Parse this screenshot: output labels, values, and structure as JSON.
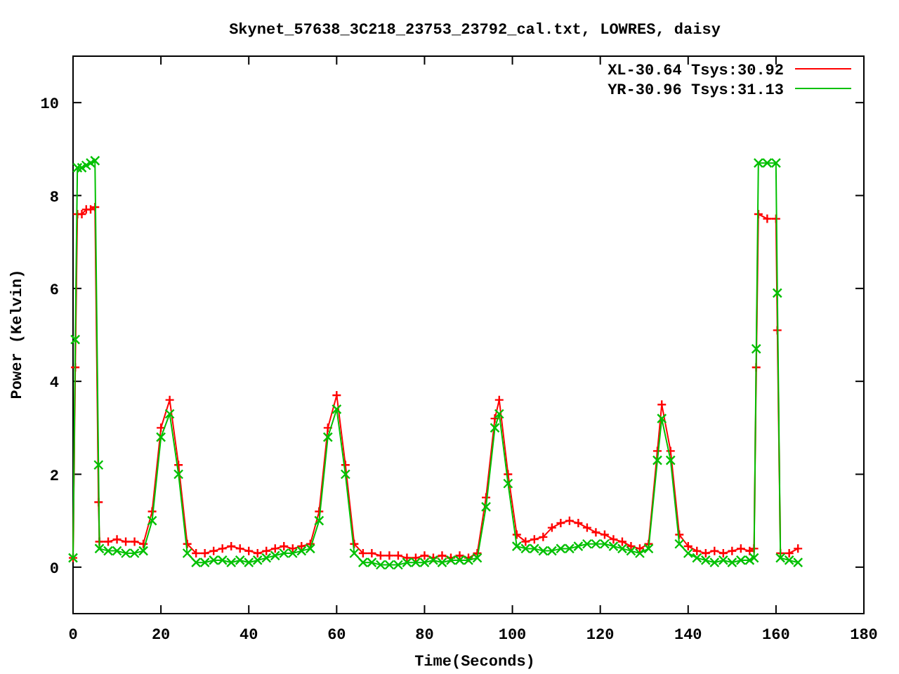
{
  "chart_data": {
    "type": "line",
    "title": "Skynet_57638_3C218_23753_23792_cal.txt, LOWRES, daisy",
    "xlabel": "Time(Seconds)",
    "ylabel": "Power (Kelvin)",
    "x": [
      0,
      0.5,
      1,
      2,
      3,
      4,
      5,
      5.8,
      6,
      8,
      10,
      12,
      14,
      16,
      18,
      20,
      22,
      24,
      26,
      28,
      30,
      32,
      34,
      36,
      38,
      40,
      42,
      44,
      46,
      48,
      50,
      52,
      54,
      56,
      58,
      60,
      62,
      64,
      66,
      68,
      70,
      72,
      74,
      76,
      78,
      80,
      82,
      84,
      86,
      88,
      90,
      92,
      94,
      96,
      97,
      99,
      101,
      103,
      105,
      107,
      109,
      111,
      113,
      115,
      117,
      119,
      121,
      123,
      125,
      127,
      129,
      131,
      133,
      134,
      136,
      138,
      140,
      142,
      144,
      146,
      148,
      150,
      152,
      154,
      155,
      155.5,
      156,
      158,
      160,
      160.3,
      161,
      163,
      165
    ],
    "series": [
      {
        "name": "XL-30.64 Tsys:30.92",
        "color": "#ff0000",
        "marker": "plus",
        "values": [
          0.2,
          4.3,
          7.6,
          7.6,
          7.7,
          7.7,
          7.75,
          1.4,
          0.55,
          0.55,
          0.6,
          0.55,
          0.55,
          0.5,
          1.2,
          3.0,
          3.6,
          2.2,
          0.5,
          0.3,
          0.3,
          0.35,
          0.4,
          0.45,
          0.4,
          0.35,
          0.3,
          0.35,
          0.4,
          0.45,
          0.4,
          0.45,
          0.5,
          1.2,
          3.0,
          3.7,
          2.2,
          0.5,
          0.3,
          0.3,
          0.25,
          0.25,
          0.25,
          0.2,
          0.2,
          0.25,
          0.2,
          0.25,
          0.2,
          0.25,
          0.2,
          0.3,
          1.5,
          3.2,
          3.6,
          2.0,
          0.7,
          0.55,
          0.6,
          0.65,
          0.85,
          0.95,
          1.0,
          0.95,
          0.85,
          0.75,
          0.7,
          0.6,
          0.55,
          0.45,
          0.4,
          0.5,
          2.5,
          3.5,
          2.5,
          0.7,
          0.45,
          0.35,
          0.3,
          0.35,
          0.3,
          0.35,
          0.4,
          0.35,
          0.4,
          4.3,
          7.6,
          7.5,
          7.5,
          5.1,
          0.3,
          0.3,
          0.4
        ]
      },
      {
        "name": "YR-30.96 Tsys:31.13",
        "color": "#00c000",
        "marker": "cross",
        "values": [
          0.2,
          4.9,
          8.6,
          8.6,
          8.65,
          8.7,
          8.75,
          2.2,
          0.4,
          0.35,
          0.35,
          0.3,
          0.3,
          0.35,
          1.0,
          2.8,
          3.3,
          2.0,
          0.3,
          0.1,
          0.1,
          0.15,
          0.15,
          0.1,
          0.15,
          0.1,
          0.15,
          0.2,
          0.25,
          0.3,
          0.3,
          0.35,
          0.4,
          1.0,
          2.8,
          3.4,
          2.0,
          0.3,
          0.1,
          0.1,
          0.05,
          0.05,
          0.05,
          0.1,
          0.1,
          0.1,
          0.15,
          0.1,
          0.15,
          0.15,
          0.15,
          0.2,
          1.3,
          3.0,
          3.3,
          1.8,
          0.45,
          0.4,
          0.4,
          0.35,
          0.35,
          0.4,
          0.4,
          0.45,
          0.5,
          0.5,
          0.5,
          0.45,
          0.4,
          0.35,
          0.3,
          0.4,
          2.3,
          3.2,
          2.3,
          0.5,
          0.3,
          0.2,
          0.15,
          0.1,
          0.15,
          0.1,
          0.15,
          0.15,
          0.2,
          4.7,
          8.7,
          8.7,
          8.7,
          5.9,
          0.2,
          0.15,
          0.1
        ]
      }
    ],
    "xlim": [
      0,
      180
    ],
    "ylim": [
      -1,
      11
    ],
    "xticks": [
      0,
      20,
      40,
      60,
      80,
      100,
      120,
      140,
      160,
      180
    ],
    "yticks": [
      0,
      2,
      4,
      6,
      8,
      10
    ],
    "legend": true
  }
}
